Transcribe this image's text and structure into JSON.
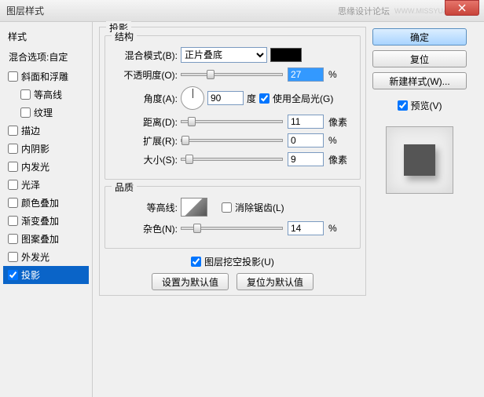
{
  "window": {
    "title": "图层样式",
    "watermark": "思缘设计论坛",
    "url": "WWW.MISSYUAN.COM"
  },
  "sidebar": {
    "title": "样式",
    "blend_options": "混合选项:自定",
    "items": [
      {
        "label": "斜面和浮雕",
        "checked": false
      },
      {
        "label": "等高线",
        "checked": false,
        "child": true
      },
      {
        "label": "纹理",
        "checked": false,
        "child": true
      },
      {
        "label": "描边",
        "checked": false
      },
      {
        "label": "内阴影",
        "checked": false
      },
      {
        "label": "内发光",
        "checked": false
      },
      {
        "label": "光泽",
        "checked": false,
        "light": true
      },
      {
        "label": "颜色叠加",
        "checked": false
      },
      {
        "label": "渐变叠加",
        "checked": false
      },
      {
        "label": "图案叠加",
        "checked": false
      },
      {
        "label": "外发光",
        "checked": false
      },
      {
        "label": "投影",
        "checked": true,
        "selected": true
      }
    ]
  },
  "panel": {
    "title": "投影",
    "structure": {
      "legend": "结构",
      "blend_mode_label": "混合模式(B):",
      "blend_mode_value": "正片叠底",
      "opacity_label": "不透明度(O):",
      "opacity_value": "27",
      "pct": "%",
      "angle_label": "角度(A):",
      "angle_value": "90",
      "deg": "度",
      "global_light": "使用全局光(G)",
      "distance_label": "距离(D):",
      "distance_value": "11",
      "px": "像素",
      "spread_label": "扩展(R):",
      "spread_value": "0",
      "size_label": "大小(S):",
      "size_value": "9"
    },
    "quality": {
      "legend": "品质",
      "contour_label": "等高线:",
      "antialias": "消除锯齿(L)",
      "noise_label": "杂色(N):",
      "noise_value": "14"
    },
    "knockout": "图层挖空投影(U)",
    "make_default": "设置为默认值",
    "reset_default": "复位为默认值"
  },
  "buttons": {
    "ok": "确定",
    "cancel": "复位",
    "new_style": "新建样式(W)...",
    "preview": "预览(V)"
  }
}
